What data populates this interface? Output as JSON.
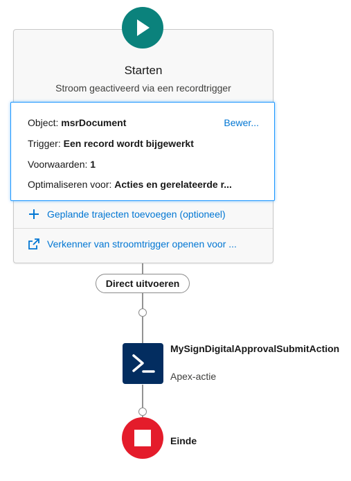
{
  "start": {
    "title": "Starten",
    "subtitle": "Stroom geactiveerd via een recordtrigger",
    "icon": "play-icon",
    "color": "#0b827c"
  },
  "details": {
    "object_label": "Object:",
    "object_value": "msrDocument",
    "edit_label": "Bewer...",
    "trigger_label": "Trigger:",
    "trigger_value": "Een record wordt bijgewerkt",
    "conditions_label": "Voorwaarden:",
    "conditions_value": "1",
    "optimize_label": "Optimaliseren voor:",
    "optimize_value": "Acties en gerelateerde r..."
  },
  "links": {
    "add_paths": "Geplande trajecten toevoegen (optioneel)",
    "add_paths_icon": "plus-icon",
    "open_explorer": "Verkenner van stroomtrigger openen voor ...",
    "open_explorer_icon": "external-link-icon"
  },
  "path": {
    "label": "Direct uitvoeren"
  },
  "action": {
    "name": "MySignDigitalApprovalSubmitAction",
    "type": "Apex-actie",
    "icon": "apex-terminal-icon",
    "color": "#032d60"
  },
  "end": {
    "label": "Einde",
    "icon": "stop-icon",
    "color": "#e41c2b"
  }
}
